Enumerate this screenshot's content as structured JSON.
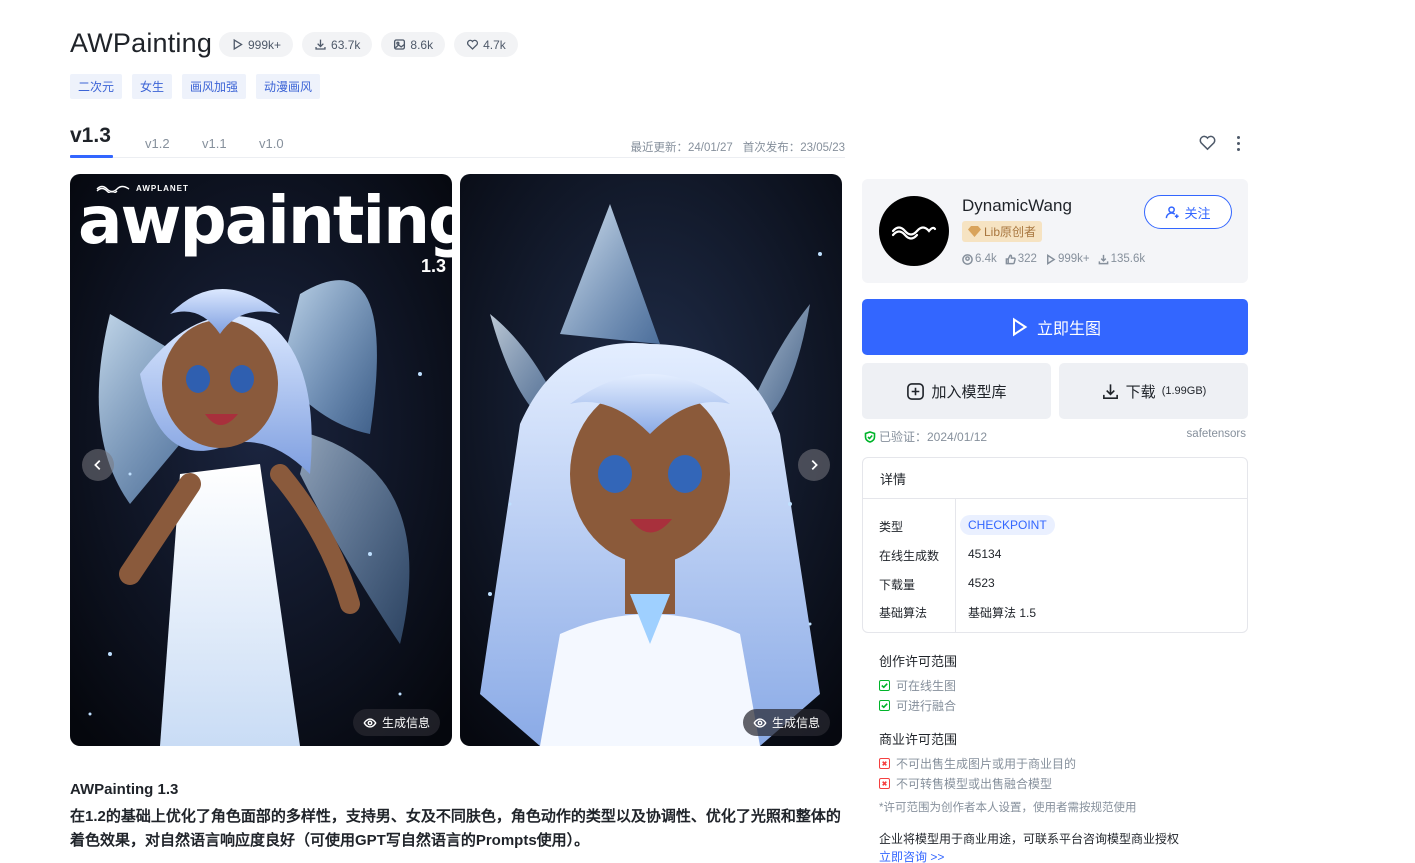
{
  "header": {
    "title": "AWPainting",
    "stats": [
      {
        "icon": "play-icon",
        "value": "999k+"
      },
      {
        "icon": "download-icon",
        "value": "63.7k"
      },
      {
        "icon": "image-icon",
        "value": "8.6k"
      },
      {
        "icon": "heart-icon",
        "value": "4.7k"
      }
    ],
    "tags": [
      "二次元",
      "女生",
      "画风加强",
      "动漫画风"
    ]
  },
  "versions": {
    "active": "v1.3",
    "others": [
      "v1.2",
      "v1.1",
      "v1.0"
    ],
    "last_update": "最近更新：24/01/27",
    "first_release": "首次发布：23/05/23"
  },
  "gallery": {
    "brand_small": "AWPLANET",
    "brand_big": "awpainting",
    "brand_version": "1.3",
    "gen_info_label": "生成信息"
  },
  "description": {
    "title": "AWPainting 1.3",
    "body": "在1.2的基础上优化了角色面部的多样性，支持男、女及不同肤色，角色动作的类型以及协调性、优化了光照和整体的着色效果，对自然语言响应度良好（可使用GPT写自然语言的Prompts使用）。"
  },
  "author": {
    "name": "DynamicWang",
    "badge": "Lib原创者",
    "follow_label": "关注",
    "stats": [
      {
        "icon": "user-icon",
        "value": "6.4k"
      },
      {
        "icon": "thumb-icon",
        "value": "322"
      },
      {
        "icon": "play-icon",
        "value": "999k+"
      },
      {
        "icon": "download-icon",
        "value": "135.6k"
      }
    ]
  },
  "actions": {
    "generate_label": "立即生图",
    "add_library_label": "加入模型库",
    "download_label": "下载",
    "download_size": "(1.99GB)",
    "verified": "已验证：2024/01/12",
    "format": "safetensors"
  },
  "details": {
    "heading": "详情",
    "rows": [
      {
        "key": "类型",
        "value": "CHECKPOINT"
      },
      {
        "key": "在线生成数",
        "value": "45134"
      },
      {
        "key": "下载量",
        "value": "4523"
      },
      {
        "key": "基础算法",
        "value": "基础算法 1.5"
      }
    ]
  },
  "license": {
    "creative_title": "创作许可范围",
    "creative_items": [
      "可在线生图",
      "可进行融合"
    ],
    "commercial_title": "商业许可范围",
    "commercial_items": [
      "不可出售生成图片或用于商业目的",
      "不可转售模型或出售融合模型"
    ],
    "note": "*许可范围为创作者本人设置，使用者需按规范使用",
    "business_note": "企业将模型用于商业用途，可联系平台咨询模型商业授权",
    "consult_link": "立即咨询 >>"
  },
  "colors": {
    "accent": "#3366ff",
    "tag_bg": "#eef2fb",
    "ok": "#00b42a",
    "no": "#f53f3f"
  }
}
